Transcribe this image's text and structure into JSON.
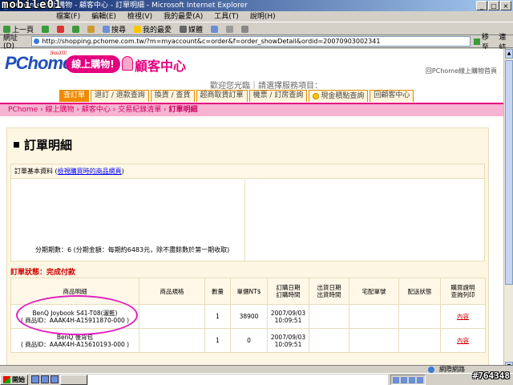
{
  "window": {
    "title": "PChome 線上購物 - 顧客中心 - 訂單明細 - Microsoft Internet Explorer",
    "watermark": "mobile01"
  },
  "menu": [
    "檔案(F)",
    "編輯(E)",
    "檢視(V)",
    "我的最愛(A)",
    "工具(T)",
    "說明(H)"
  ],
  "toolbar": {
    "back": "上一頁",
    "search": "搜尋",
    "favorites": "我的最愛",
    "media": "媒體"
  },
  "address": {
    "label": "網址(D)",
    "url": "http://shopping.pchome.com.tw/?m=myaccount&c=order&f=order_showDetail&ordid=20070903002341",
    "go": "移至",
    "links": "連結"
  },
  "header": {
    "logo": "PChome",
    "since": "Since 2000",
    "badge": "線上購物!",
    "service_title": "顧客中心",
    "return_link": "回PChome線上購物首頁",
    "welcome": "歡迎您光臨｜請選擇服務項目："
  },
  "tabs": [
    {
      "label": "查訂單",
      "active": true
    },
    {
      "label": "退訂 / 退款查詢",
      "active": false
    },
    {
      "label": "換貨 / 查貨",
      "active": false
    },
    {
      "label": "超商取貨訂單",
      "active": false
    },
    {
      "label": "機票 / 訂房查詢",
      "active": false
    },
    {
      "label": "現金積點查詢",
      "active": false,
      "icon": "coin-icon"
    },
    {
      "label": "回顧客中心",
      "active": false
    }
  ],
  "breadcrumb": {
    "part1": "PChome › 線上購物 › 顧客中心 › 交易紀錄清單 › ",
    "current": "訂單明細"
  },
  "page": {
    "title": "訂單明細",
    "basic_header": "訂單基本資料 (",
    "basic_link": "檢視購買時的商品網頁",
    "basic_header_end": ")",
    "installment": "分期期數：6 (分期金額：每期約6483元，除不盡餘數於第一期收取)",
    "status_label": "訂單狀態：",
    "status_value": "完成付款"
  },
  "table": {
    "headers": [
      "商品明細",
      "商品規格",
      "數量",
      "單價NT$",
      "訂購日期\n訂購時間",
      "出貨日期\n出貨時間",
      "宅配單號",
      "配送狀態",
      "購買證明\n查詢列印"
    ],
    "rows": [
      {
        "name": "BenQ Joybook S41-T08(灑藍)",
        "id": "( 商品ID：AAAK4H-A15911870-000 )",
        "spec": "",
        "qty": "1",
        "price": "38900",
        "order_date": "2007/09/03",
        "order_time": "10:09:51",
        "ship": "",
        "tracking": "",
        "delivery": "",
        "proof": "內容"
      },
      {
        "name": "BenQ 後背包",
        "id": "( 商品ID：AAAK4H-A15610193-000 )",
        "spec": "",
        "qty": "1",
        "price": "0",
        "order_date": "2007/09/03",
        "order_time": "10:09:51",
        "ship": "",
        "tracking": "",
        "delivery": "",
        "proof": "內容"
      }
    ]
  },
  "statusbar": {
    "zone": "網際網路"
  },
  "taskbar": {
    "start": "開始",
    "watermark_id": "#764348"
  },
  "colors": {
    "brand_pink": "#e4007f",
    "tab_orange": "#f08a00",
    "status_red": "#d00000",
    "highlight_circle": "#e020c0"
  }
}
